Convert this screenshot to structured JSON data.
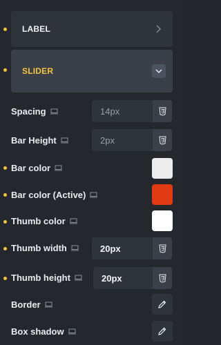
{
  "sections": {
    "label": {
      "title": "LABEL",
      "state": "collapsed"
    },
    "slider": {
      "title": "SLIDER",
      "state": "expanded"
    }
  },
  "controls": {
    "spacing": {
      "label": "Spacing",
      "placeholder": "14px"
    },
    "bar_height": {
      "label": "Bar Height",
      "placeholder": "2px"
    },
    "bar_color": {
      "label": "Bar color",
      "color": "#ececec"
    },
    "bar_color_active": {
      "label": "Bar color (Active)",
      "color": "#e03a12"
    },
    "thumb_color": {
      "label": "Thumb color",
      "color": "#ffffff"
    },
    "thumb_width": {
      "label": "Thumb width",
      "value": "20px"
    },
    "thumb_height": {
      "label": "Thumb height",
      "value": "20px"
    },
    "border": {
      "label": "Border"
    },
    "box_shadow": {
      "label": "Box shadow"
    }
  },
  "colors": {
    "accent": "#f4c542",
    "panel": "#24272c",
    "control_bg": "#2f333a"
  },
  "icons": {
    "device": "desktop-icon",
    "css": "css3-icon",
    "edit": "pencil-icon",
    "chevron_right": "chevron-right-icon",
    "chevron_down": "chevron-down-icon"
  }
}
